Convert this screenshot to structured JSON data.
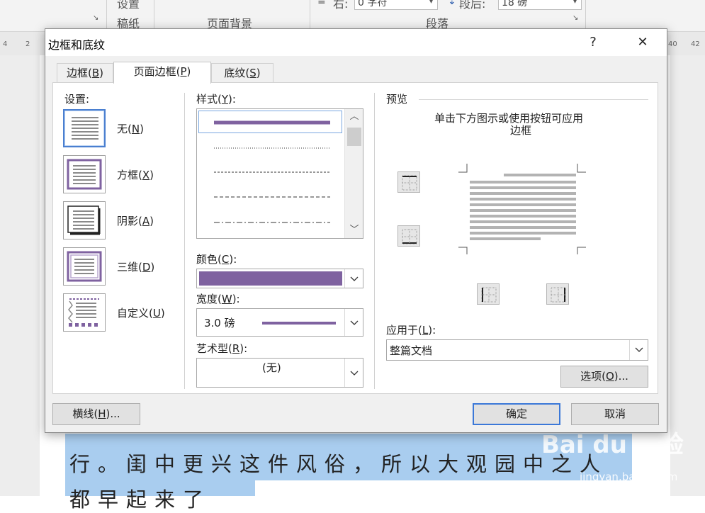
{
  "ribbon": {
    "group_setup_top": "设置",
    "group_draft": "稿纸",
    "group_page_bg": "页面背景",
    "group_paragraph": "段落",
    "right_label": "右:",
    "right_value": "0 字符",
    "after_label": "段后:",
    "after_value": "18 磅"
  },
  "ruler": {
    "left_nums": [
      "4",
      "2"
    ],
    "right_nums": [
      "40",
      "42"
    ]
  },
  "document": {
    "line1": "行。闺中更兴这件风俗，所以大观园中之人",
    "line2": "都早起来了"
  },
  "watermark": {
    "logo": "Bai du 经验",
    "url": "jingyan.baidu.com"
  },
  "dialog": {
    "title": "边框和底纹",
    "help_btn": "?",
    "close_btn": "✕",
    "tabs": [
      {
        "label": "边框(",
        "key": "B",
        "end": ")"
      },
      {
        "label": "页面边框(",
        "key": "P",
        "end": ")"
      },
      {
        "label": "底纹(",
        "key": "S",
        "end": ")"
      }
    ],
    "settings": {
      "heading": "设置:",
      "items": [
        {
          "label": "无(",
          "key": "N",
          "end": ")"
        },
        {
          "label": "方框(",
          "key": "X",
          "end": ")"
        },
        {
          "label": "阴影(",
          "key": "A",
          "end": ")"
        },
        {
          "label": "三维(",
          "key": "D",
          "end": ")"
        },
        {
          "label": "自定义(",
          "key": "U",
          "end": ")"
        }
      ]
    },
    "style": {
      "label": "样式(",
      "key": "Y",
      "end": "):"
    },
    "color": {
      "label": "颜色(",
      "key": "C",
      "end": "):",
      "value_color": "#7f62a0"
    },
    "width": {
      "label": "宽度(",
      "key": "W",
      "end": "):",
      "value": "3.0 磅"
    },
    "art": {
      "label": "艺术型(",
      "key": "R",
      "end": "):",
      "value": "(无)"
    },
    "preview": {
      "heading": "预览",
      "hint_line1": "单击下方图示或使用按钮可应用",
      "hint_line2": "边框"
    },
    "apply": {
      "label": "应用于(",
      "key": "L",
      "end": "):",
      "value": "整篇文档"
    },
    "options_btn": {
      "label": "选项(",
      "key": "O",
      "end": ")..."
    },
    "hline_btn": {
      "label": "横线(",
      "key": "H",
      "end": ")..."
    },
    "ok_btn": "确定",
    "cancel_btn": "取消",
    "accent": "#7f62a0"
  }
}
